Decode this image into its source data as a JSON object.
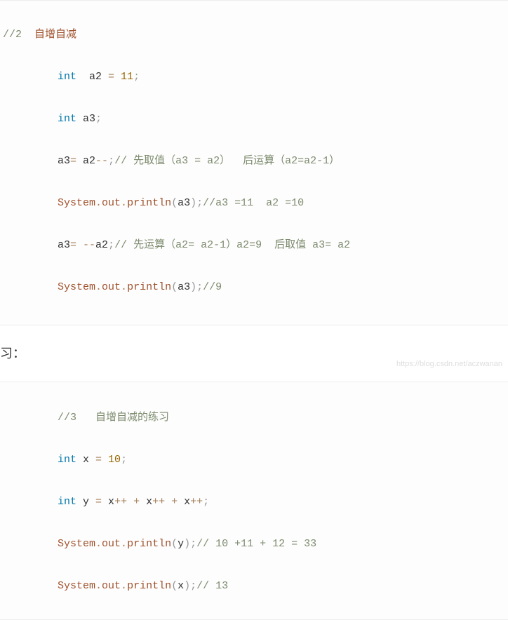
{
  "block1": {
    "c1_a": "//2",
    "c1_b": "  自增自减",
    "l2_kw": "int",
    "l2_sp": "  a2 ",
    "l2_op": "=",
    "l2_num": " 11",
    "l2_semi": ";",
    "l3_kw": "int",
    "l3_rest": " a3",
    "l3_semi": ";",
    "l4_a": "a3",
    "l4_op1": "= ",
    "l4_b": "a2",
    "l4_op2": "--",
    "l4_semi": ";",
    "l4_cmt": "// 先取值（a3 = a2）  后运算（a2=a2-1）",
    "l5_a": "System",
    "l5_dot1": ".",
    "l5_b": "out",
    "l5_dot2": ".",
    "l5_c": "println",
    "l5_lp": "(",
    "l5_arg": "a3",
    "l5_rp": ")",
    "l5_semi": ";",
    "l5_cmt": "//a3 =11  a2 =10",
    "l6_a": "a3",
    "l6_op1": "= ",
    "l6_op2": "--",
    "l6_b": "a2",
    "l6_semi": ";",
    "l6_cmt": "// 先运算（a2= a2-1）a2=9  后取值 a3= a2",
    "l7_a": "System",
    "l7_dot1": ".",
    "l7_b": "out",
    "l7_dot2": ".",
    "l7_c": "println",
    "l7_lp": "(",
    "l7_arg": "a3",
    "l7_rp": ")",
    "l7_semi": ";",
    "l7_cmt": "//9"
  },
  "between": "习：",
  "block2": {
    "c1": "//3   自增自减的练习",
    "l2_kw": "int",
    "l2_x": " x ",
    "l2_op": "=",
    "l2_num": " 10",
    "l2_semi": ";",
    "l3_kw": "int",
    "l3_y": " y ",
    "l3_op1": "=",
    "l3_sp1": " x",
    "l3_pp1": "++ + ",
    "l3_x2": "x",
    "l3_pp2": "++ + ",
    "l3_x3": "x",
    "l3_pp3": "++",
    "l3_semi": ";",
    "l4_a": "System",
    "l4_dot1": ".",
    "l4_b": "out",
    "l4_dot2": ".",
    "l4_c": "println",
    "l4_lp": "(",
    "l4_arg": "y",
    "l4_rp": ")",
    "l4_semi": ";",
    "l4_cmt": "// 10 +11 + 12 = 33",
    "l5_a": "System",
    "l5_dot1": ".",
    "l5_b": "out",
    "l5_dot2": ".",
    "l5_c": "println",
    "l5_lp": "(",
    "l5_arg": "x",
    "l5_rp": ")",
    "l5_semi": ";",
    "l5_cmt": "// 13"
  },
  "watermark": "https://blog.csdn.net/aczwanan"
}
